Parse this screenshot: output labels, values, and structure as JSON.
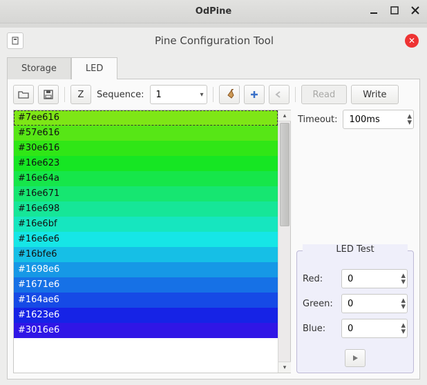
{
  "window": {
    "title": "OdPine"
  },
  "header": {
    "title": "Pine Configuration Tool"
  },
  "tabs": {
    "storage": "Storage",
    "led": "LED",
    "active": "led"
  },
  "toolbar": {
    "sequence_label": "Sequence:",
    "sequence_value": "1",
    "read_label": "Read",
    "write_label": "Write",
    "z_label": "Z"
  },
  "timeout": {
    "label": "Timeout:",
    "value": "100ms"
  },
  "led_test": {
    "legend": "LED Test",
    "rows": [
      {
        "label": "Red:",
        "value": "0"
      },
      {
        "label": "Green:",
        "value": "0"
      },
      {
        "label": "Blue:",
        "value": "0"
      }
    ]
  },
  "colors": [
    {
      "hex": "#7ee616",
      "selected": true
    },
    {
      "hex": "#57e616"
    },
    {
      "hex": "#30e616"
    },
    {
      "hex": "#16e623"
    },
    {
      "hex": "#16e64a"
    },
    {
      "hex": "#16e671"
    },
    {
      "hex": "#16e698"
    },
    {
      "hex": "#16e6bf"
    },
    {
      "hex": "#16e6e6"
    },
    {
      "hex": "#16bfe6"
    },
    {
      "hex": "#1698e6"
    },
    {
      "hex": "#1671e6"
    },
    {
      "hex": "#164ae6"
    },
    {
      "hex": "#1623e6"
    },
    {
      "hex": "#3016e6"
    }
  ]
}
